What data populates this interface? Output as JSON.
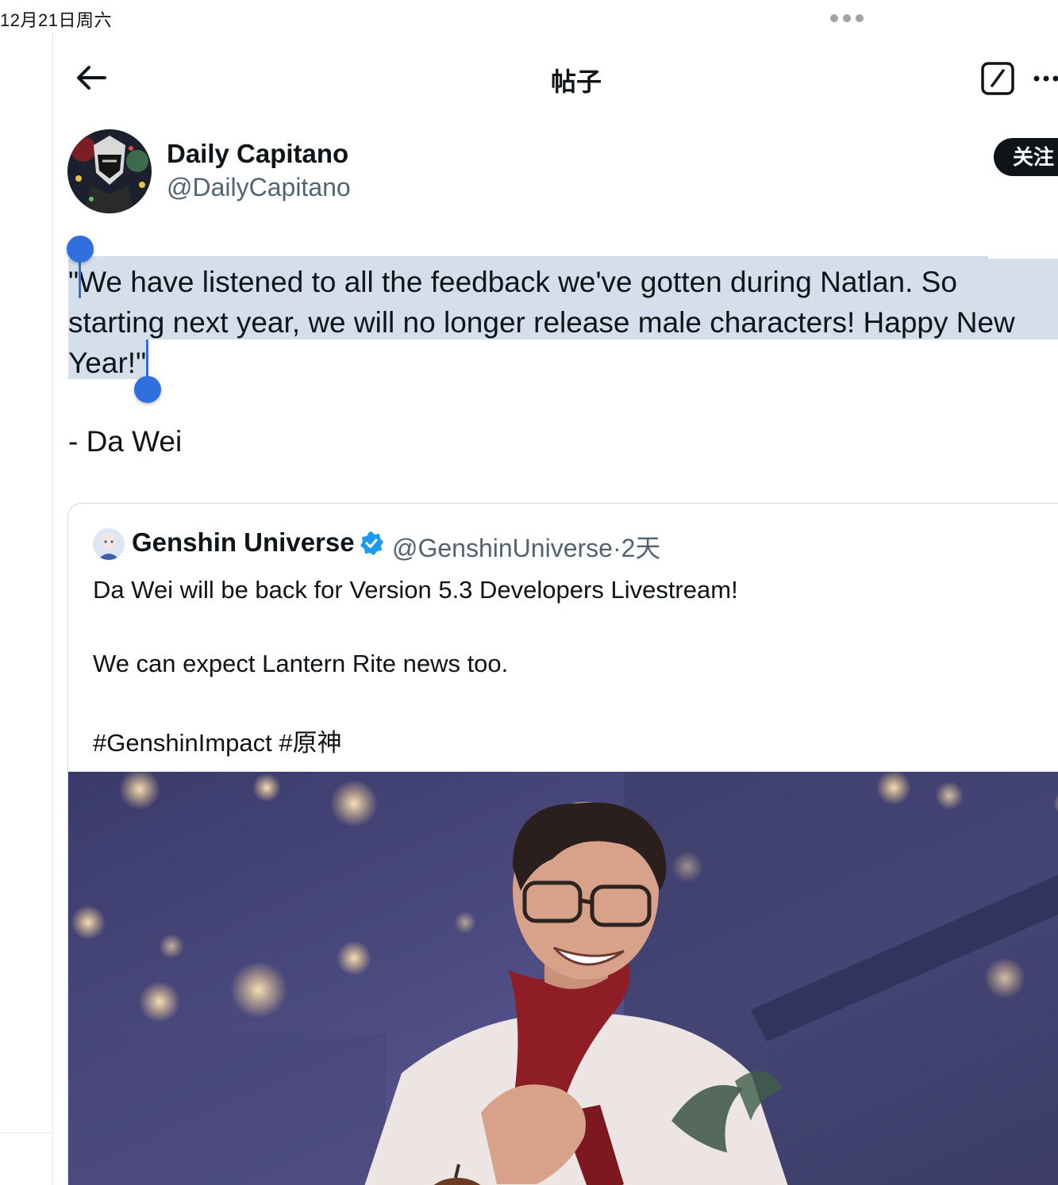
{
  "status_bar": {
    "date": "12月21日周六"
  },
  "header": {
    "title": "帖子"
  },
  "author": {
    "display_name": "Daily Capitano",
    "handle": "@DailyCapitano",
    "follow_label": "关注"
  },
  "tweet": {
    "lines": [
      "\"We have listened to all the feedback we've gotten during Natlan. So",
      "starting next year, we will no longer release male characters! Happy New",
      "Year!\""
    ],
    "signature": "- Da Wei",
    "selected": true
  },
  "quote": {
    "display_name": "Genshin Universe",
    "verified": true,
    "handle_time": "@GenshinUniverse·2天",
    "lines": [
      "Da Wei will be back for Version 5.3 Developers Livestream!",
      "We can expect Lantern Rite news too.",
      "#GenshinImpact #原神"
    ]
  },
  "colors": {
    "selection": "#d4dfeb",
    "selection_handle": "#2f6fe0",
    "follow_button_bg": "#0f1419",
    "verified": "#1d9bf0",
    "secondary_text": "#536471"
  },
  "icons": [
    "back-arrow-icon",
    "compose-icon",
    "more-horizontal-icon",
    "verified-badge-icon"
  ]
}
